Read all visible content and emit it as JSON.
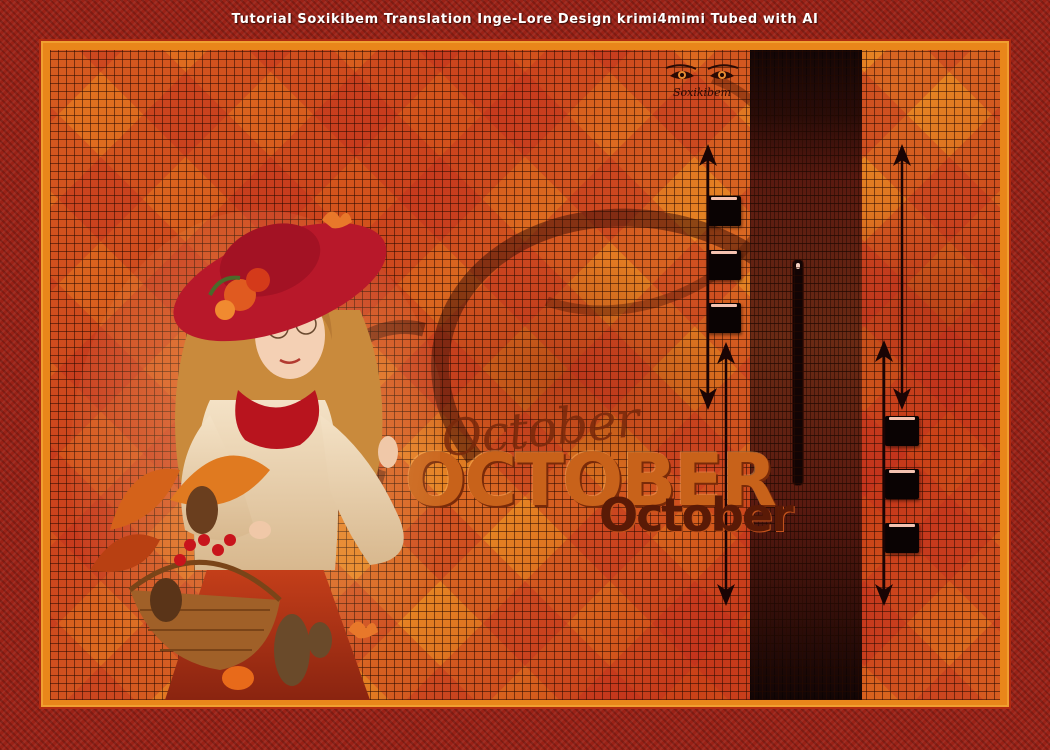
{
  "header": {
    "credit": "Tutorial Soxikibem Translation Inge-Lore Design krimi4mimi Tubed with AI"
  },
  "artwork": {
    "title_script": "October",
    "title_block": "OCTOBER",
    "title_secondary": "October",
    "signature": "Soxikibem",
    "illustration": "autumn-woman-with-hat-and-basket",
    "colors": {
      "border": "#9a2116",
      "background": "#e47820",
      "accent": "#c8621a",
      "dark": "#1a0606"
    }
  }
}
